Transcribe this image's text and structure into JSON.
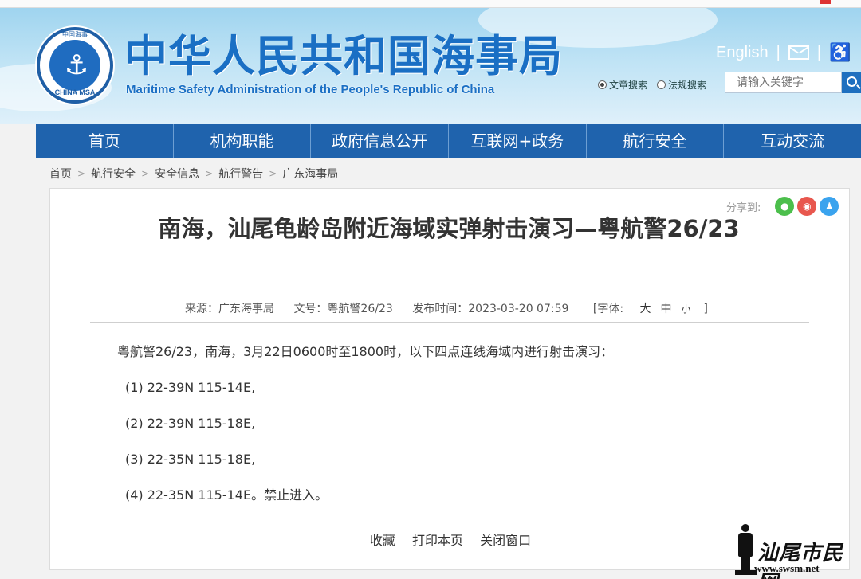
{
  "header": {
    "title": "中华人民共和国海事局",
    "subtitle": "Maritime Safety Administration of the People's Republic of China",
    "logo_top_text": "中国海事",
    "logo_bottom_text": "CHINA MSA",
    "english_link": "English",
    "sep": "|",
    "search": {
      "option_articles": "文章搜索",
      "option_regulations": "法规搜索",
      "placeholder": "请输入关键字"
    }
  },
  "nav": [
    "首页",
    "机构职能",
    "政府信息公开",
    "互联网+政务",
    "航行安全",
    "互动交流"
  ],
  "breadcrumb": [
    "首页",
    "航行安全",
    "安全信息",
    "航行警告",
    "广东海事局"
  ],
  "article": {
    "share_label": "分享到:",
    "title": "南海，汕尾龟龄岛附近海域实弹射击演习—粤航警26/23",
    "source": "来源：广东海事局",
    "doc_no": "文号：粤航警26/23",
    "published": "发布时间：2023-03-20 07:59",
    "font_label": "[字体:",
    "font_large": "大",
    "font_medium": "中",
    "font_small": "小",
    "font_close": "]",
    "lead": "粤航警26/23，南海，3月22日0600时至1800时，以下四点连线海域内进行射击演习：",
    "points": [
      "(1)  22-39N 115-14E,",
      "(2)  22-39N 115-18E,",
      "(3)  22-35N 115-18E,",
      "(4)  22-35N 115-14E。禁止进入。"
    ],
    "actions": [
      "收藏",
      "打印本页",
      "关闭窗口"
    ]
  },
  "watermark": {
    "text": "汕尾市民网",
    "url": "www.swsm.net"
  },
  "colors": {
    "nav_bg": "#1f63ad",
    "brand_blue": "#1a6fc4",
    "share_wechat": "#4cbf4c",
    "share_weibo": "#e8574e",
    "share_qq": "#3aa3ee"
  }
}
